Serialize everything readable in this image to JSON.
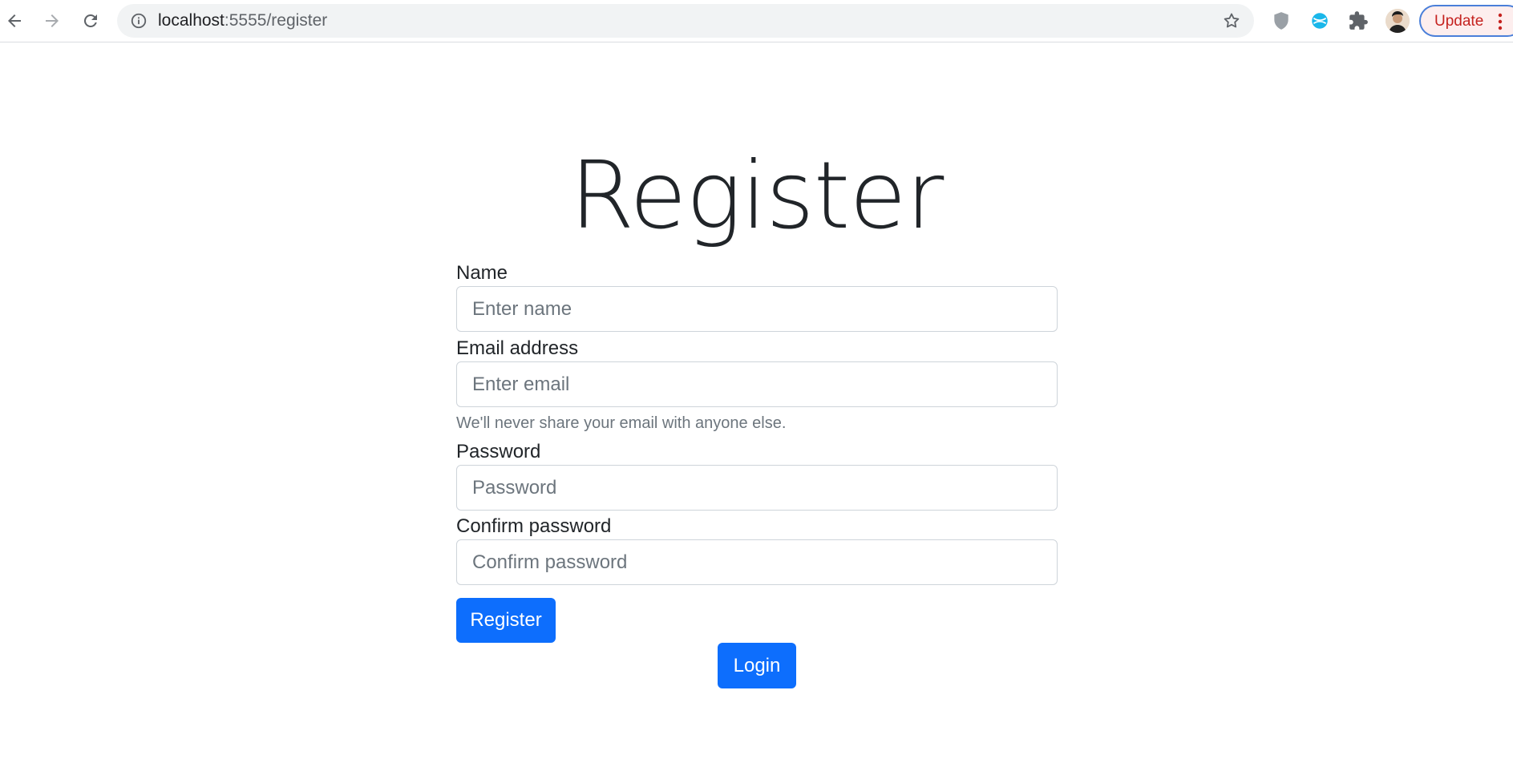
{
  "browser": {
    "url_host": "localhost",
    "url_path": ":5555/register",
    "update_label": "Update",
    "icons": {
      "back": "arrow-left-icon",
      "forward": "arrow-right-icon",
      "reload": "reload-icon",
      "site_info": "info-icon",
      "bookmark": "star-icon",
      "extension_1": "shield-icon",
      "extension_2": "globe-icon",
      "extensions": "puzzle-icon",
      "menu": "kebab-menu-icon"
    }
  },
  "page": {
    "title": "Register",
    "form": {
      "name_label": "Name",
      "name_placeholder": "Enter name",
      "email_label": "Email address",
      "email_placeholder": "Enter email",
      "email_help": "We'll never share your email with anyone else.",
      "password_label": "Password",
      "password_placeholder": "Password",
      "confirm_label": "Confirm password",
      "confirm_placeholder": "Confirm password",
      "register_button": "Register"
    },
    "login_button": "Login"
  },
  "colors": {
    "primary": "#0d6efd",
    "text": "#212529",
    "muted": "#6c757d",
    "border": "#ced4da",
    "update_text": "#c5221f"
  }
}
